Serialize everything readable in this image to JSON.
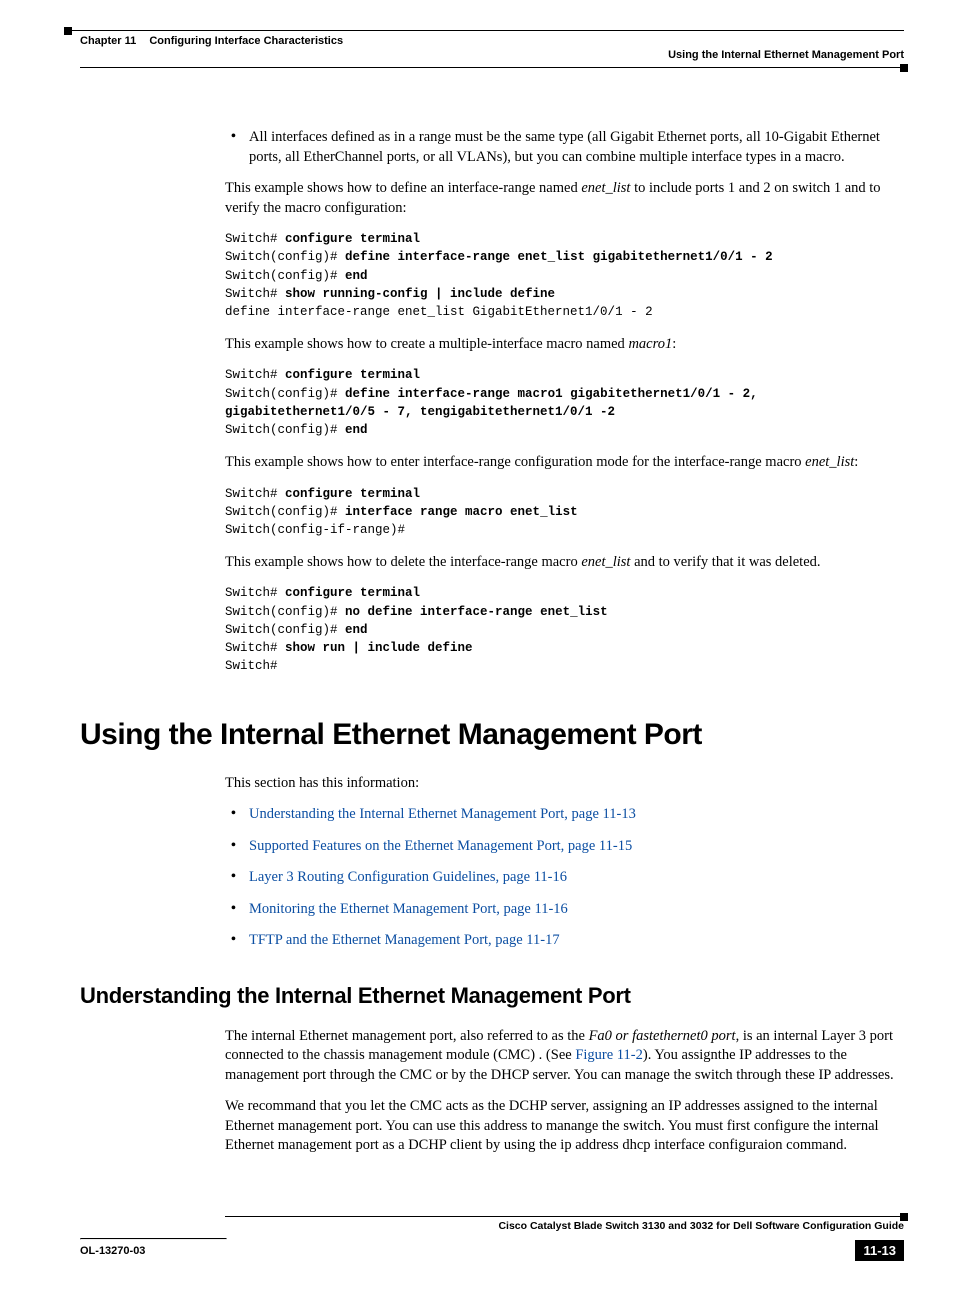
{
  "header": {
    "chapter_num": "Chapter 11",
    "chapter_title": "Configuring Interface Characteristics",
    "section_title": "Using the Internal Ethernet Management Port"
  },
  "bullet_intro": "All interfaces defined as in a range must be the same type (all Gigabit Ethernet ports, all 10-Gigabit Ethernet ports, all EtherChannel ports, or all VLANs), but you can combine multiple interface types in a macro.",
  "para1_pre": "This example shows how to define an interface-range named ",
  "para1_em": "enet_list",
  "para1_post": " to include ports 1 and 2 on switch 1 and to verify the macro configuration:",
  "code1": {
    "l1a": "Switch# ",
    "l1b": "configure terminal",
    "l2a": "Switch(config)# ",
    "l2b": "define interface-range enet_list gigabitethernet1/0/1 - 2",
    "l3a": "Switch(config)# ",
    "l3b": "end",
    "l4a": "Switch# ",
    "l4b": "show running-config | include define",
    "l5": "define interface-range enet_list GigabitEthernet1/0/1 - 2"
  },
  "para2_pre": "This example shows how to create a multiple-interface macro named ",
  "para2_em": "macro1",
  "para2_post": ":",
  "code2": {
    "l1a": "Switch# ",
    "l1b": "configure terminal",
    "l2a": "Switch(config)# ",
    "l2b": "define interface-range macro1 gigabitethernet1/0/1 - 2, gigabitethernet1/0/5 - 7, tengigabitethernet1/0/1 -2",
    "l3a": "Switch(config)# ",
    "l3b": "end"
  },
  "para3_pre": "This example shows how to enter interface-range configuration mode for the interface-range macro ",
  "para3_em": "enet_list",
  "para3_post": ":",
  "code3": {
    "l1a": "Switch# ",
    "l1b": "configure terminal",
    "l2a": "Switch(config)# ",
    "l2b": "interface range macro enet_list",
    "l3": "Switch(config-if-range)#"
  },
  "para4_pre": "This example shows how to delete the interface-range macro ",
  "para4_em": "enet_list",
  "para4_post": " and to verify that it was deleted.",
  "code4": {
    "l1a": "Switch# ",
    "l1b": "configure terminal",
    "l2a": "Switch(config)# ",
    "l2b": "no define interface-range enet_list",
    "l3a": "Switch(config)# ",
    "l3b": "end",
    "l4a": "Switch# ",
    "l4b": "show run | include define",
    "l5": "Switch#"
  },
  "h1": "Using the Internal Ethernet Management Port",
  "intro2": "This section has this information:",
  "links": [
    "Understanding the Internal Ethernet Management Port, page 11-13",
    "Supported Features on the Ethernet Management Port, page 11-15",
    "Layer 3 Routing Configuration Guidelines, page 11-16",
    "Monitoring the Ethernet Management Port, page 11-16",
    "TFTP and the Ethernet Management Port, page 11-17"
  ],
  "h2": "Understanding the Internal Ethernet Management Port",
  "para5_pre": "The internal Ethernet management port, also referred to as the ",
  "para5_em": "Fa0 or fastethernet0 port",
  "para5_mid": ", is an internal Layer 3 port connected to the chassis management module (CMC) . (See ",
  "para5_link": "Figure 11-2",
  "para5_post": "). You assignthe IP addresses to the management port through the CMC or by the DHCP server. You can manage the switch through these IP addresses.",
  "para6": "We recommand that you let the CMC acts as the DCHP server, assigning an IP addresses assigned to the internal Ethernet management port. You can use this address to manange the switch. You must first configure the internal Ethernet management port as a DCHP client by using the ip address dhcp interface configuraion command.",
  "footer": {
    "guide_title": "Cisco Catalyst Blade Switch 3130 and 3032 for Dell Software Configuration Guide",
    "doc_id": "OL-13270-03",
    "page_num": "11-13"
  }
}
